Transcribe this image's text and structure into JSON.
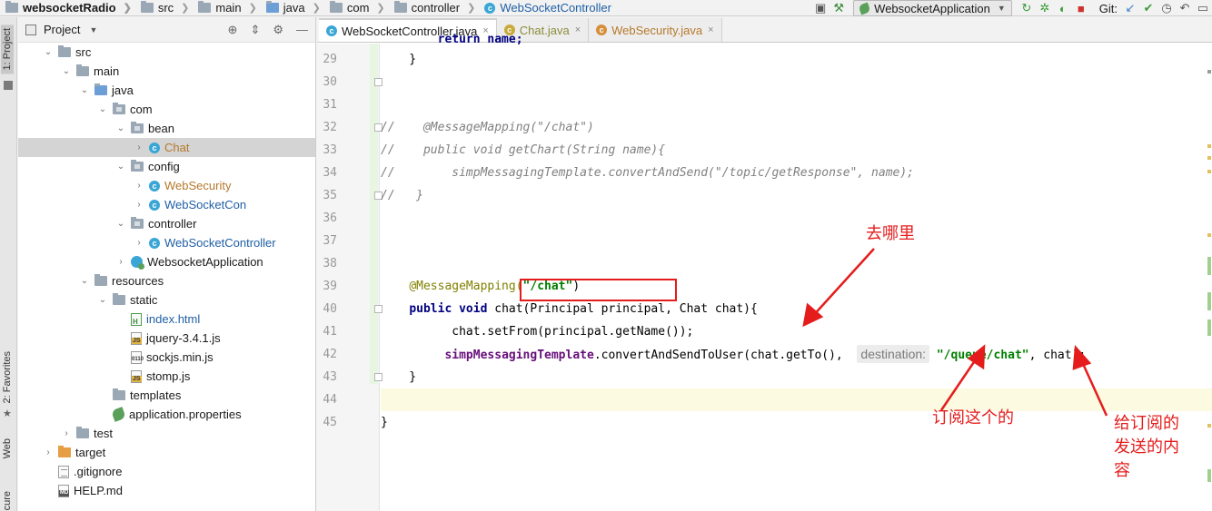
{
  "breadcrumb": {
    "project": "websocketRadio",
    "src": "src",
    "main": "main",
    "java": "java",
    "com": "com",
    "controller": "controller",
    "file": "WebSocketController"
  },
  "toolbar": {
    "run_config": "WebsocketApplication",
    "git_label": "Git:"
  },
  "left_strip": {
    "project_tab": "1: Project",
    "favorites_tab": "2: Favorites",
    "web_tab": "Web",
    "structure_tab": "cure"
  },
  "project_panel": {
    "title": "Project"
  },
  "tree": [
    {
      "label": "src",
      "depth": 1,
      "state": "open",
      "kind": "folder"
    },
    {
      "label": "main",
      "depth": 2,
      "state": "open",
      "kind": "folder"
    },
    {
      "label": "java",
      "depth": 3,
      "state": "open",
      "kind": "folder-src"
    },
    {
      "label": "com",
      "depth": 4,
      "state": "open",
      "kind": "package"
    },
    {
      "label": "bean",
      "depth": 5,
      "state": "open",
      "kind": "package"
    },
    {
      "label": "Chat",
      "depth": 6,
      "state": "closed",
      "kind": "class",
      "color": "orange",
      "selected": true
    },
    {
      "label": "config",
      "depth": 5,
      "state": "open",
      "kind": "package"
    },
    {
      "label": "WebSecurity",
      "depth": 6,
      "state": "closed",
      "kind": "class",
      "color": "orange"
    },
    {
      "label": "WebSocketCon",
      "depth": 6,
      "state": "closed",
      "kind": "class",
      "color": "blue"
    },
    {
      "label": "controller",
      "depth": 5,
      "state": "open",
      "kind": "package"
    },
    {
      "label": "WebSocketController",
      "depth": 6,
      "state": "closed",
      "kind": "class",
      "color": "blue"
    },
    {
      "label": "WebsocketApplication",
      "depth": 5,
      "state": "closed",
      "kind": "app"
    },
    {
      "label": "resources",
      "depth": 3,
      "state": "open",
      "kind": "folder-res"
    },
    {
      "label": "static",
      "depth": 4,
      "state": "open",
      "kind": "folder"
    },
    {
      "label": "index.html",
      "depth": 5,
      "state": "none",
      "kind": "html",
      "color": "blue"
    },
    {
      "label": "jquery-3.4.1.js",
      "depth": 5,
      "state": "none",
      "kind": "js"
    },
    {
      "label": "sockjs.min.js",
      "depth": 5,
      "state": "none",
      "kind": "bin"
    },
    {
      "label": "stomp.js",
      "depth": 5,
      "state": "none",
      "kind": "js"
    },
    {
      "label": "templates",
      "depth": 4,
      "state": "none",
      "kind": "folder"
    },
    {
      "label": "application.properties",
      "depth": 4,
      "state": "none",
      "kind": "leaf"
    },
    {
      "label": "test",
      "depth": 2,
      "state": "closed",
      "kind": "folder"
    },
    {
      "label": "target",
      "depth": 1,
      "state": "closed",
      "kind": "folder-orange"
    },
    {
      "label": ".gitignore",
      "depth": 1,
      "state": "none",
      "kind": "txt"
    },
    {
      "label": "HELP.md",
      "depth": 1,
      "state": "none",
      "kind": "md"
    }
  ],
  "tabs": [
    {
      "label": "WebSocketController.java",
      "close": "×",
      "active": true,
      "color": "blue"
    },
    {
      "label": "Chat.java",
      "close": "×",
      "active": false,
      "color": "gold"
    },
    {
      "label": "WebSecurity.java",
      "close": "×",
      "active": false,
      "color": "orange"
    }
  ],
  "code": {
    "line_numbers": [
      "29",
      "30",
      "31",
      "32",
      "33",
      "34",
      "35",
      "36",
      "37",
      "38",
      "39",
      "40",
      "41",
      "42",
      "43",
      "44",
      "45"
    ],
    "l28_partial": "        return name;",
    "l29": "    }",
    "l31": "//    @MessageMapping(\"/chat\")",
    "l32": "//    public void getChart(String name){",
    "l33": "//        simpMessagingTemplate.convertAndSend(\"/topic/getResponse\", name);",
    "l34": "//   }",
    "l38_ann": "@MessageMapping(",
    "l38_str": "\"/chat\"",
    "l38_end": ")",
    "l39_kw1": "public",
    "l39_kw2": "void",
    "l39_rest": "chat(Principal principal, Chat chat){",
    "l40": "chat.setFrom(principal.getName());",
    "l41_field": "simpMessagingTemplate",
    "l41_call": ".convertAndSendToUser(chat.getTo(), ",
    "l41_hint": "destination:",
    "l41_str": "\"/queue/chat\"",
    "l41_end": ", chat);",
    "l42": "    }",
    "l44": "}"
  },
  "annotations": {
    "where_to": "去哪里",
    "subscribe_this": "订阅这个的",
    "content_line1": "给订阅的",
    "content_line2": "发送的内",
    "content_line3": "容"
  },
  "colors": {
    "annotation_red": "#e51c1c",
    "keyword": "#000080",
    "string": "#008000",
    "annotation": "#808000",
    "comment": "#808080",
    "field": "#660e7a"
  }
}
